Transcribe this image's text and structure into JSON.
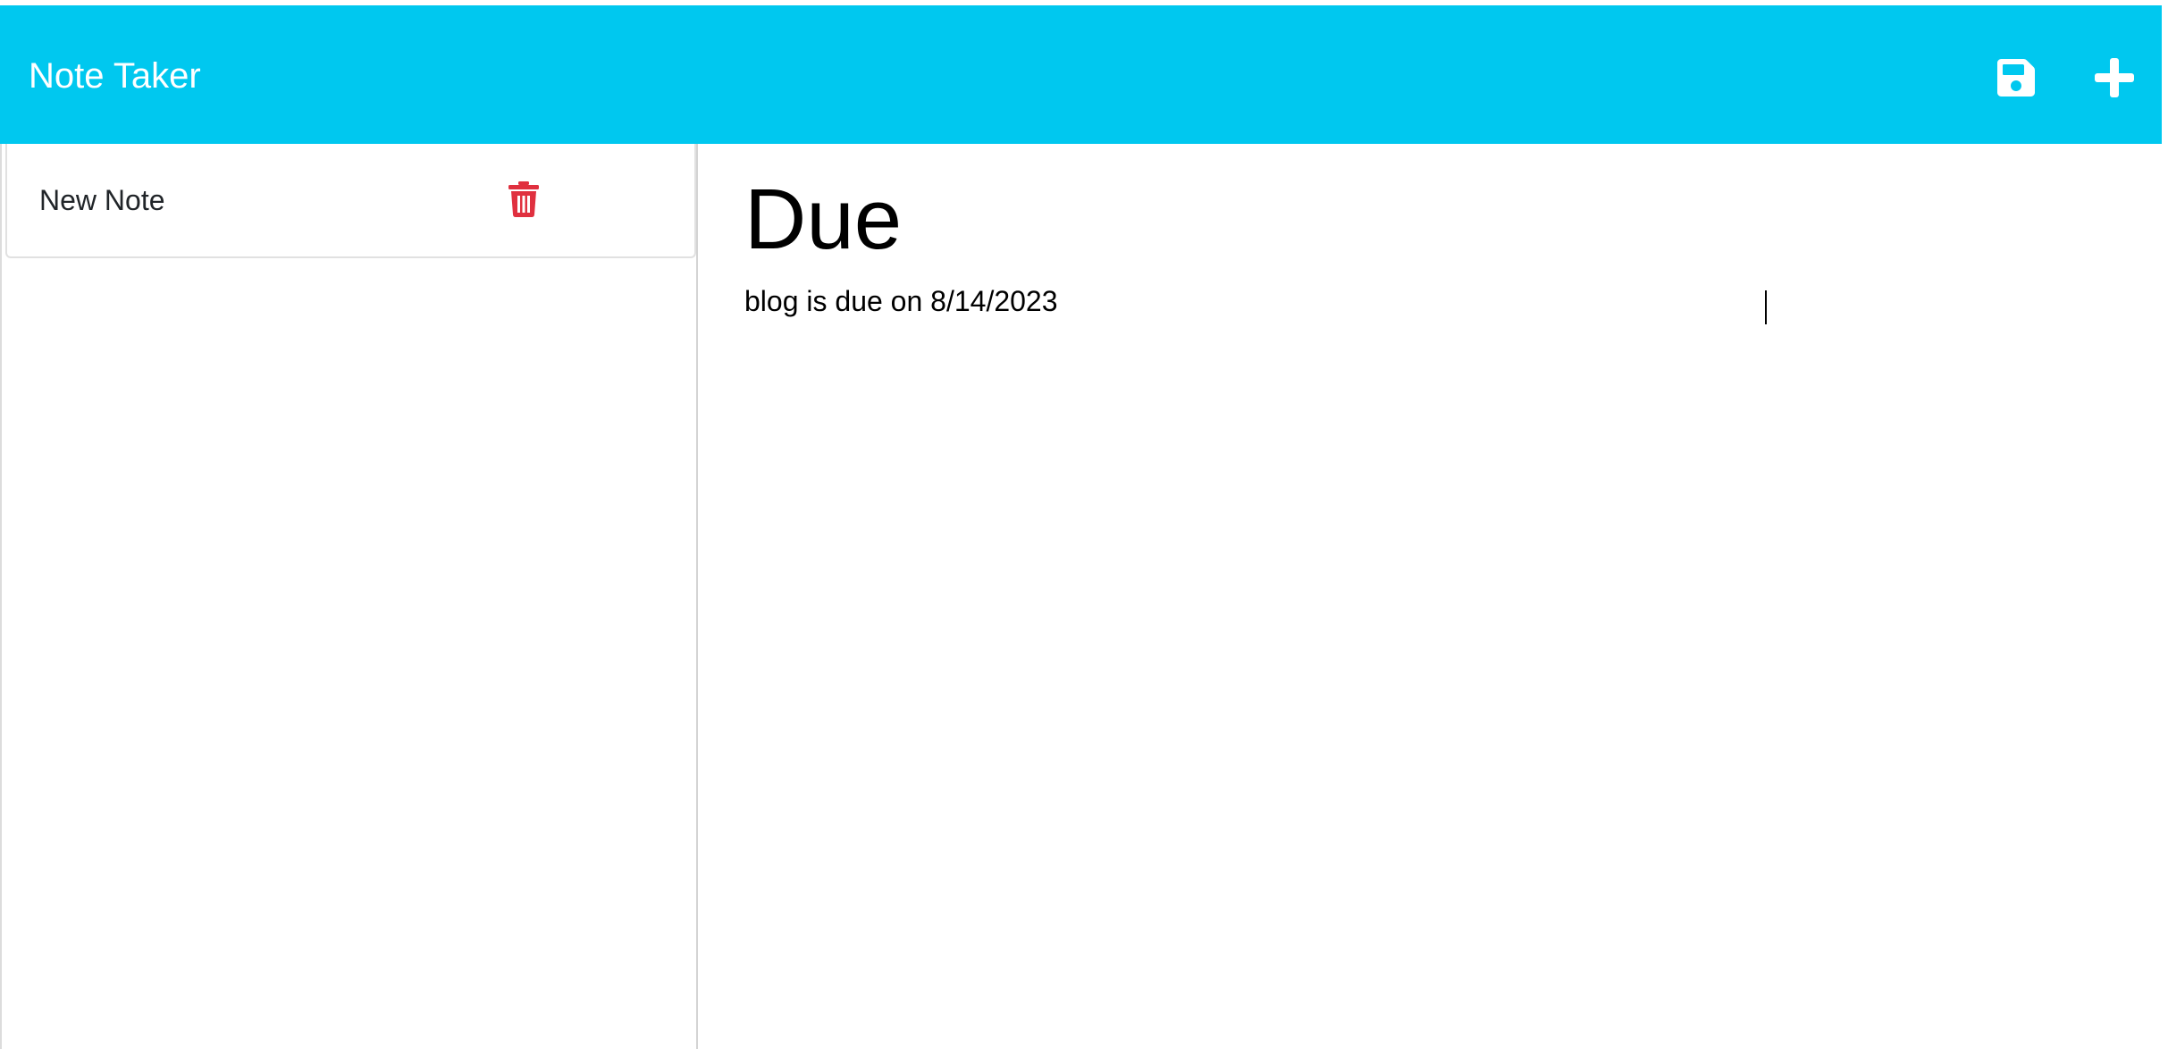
{
  "app": {
    "title": "Note Taker",
    "header_color": "#00c8ef"
  },
  "toolbar": {
    "save_icon": "save-icon",
    "add_icon": "plus-icon"
  },
  "sidebar": {
    "notes": [
      {
        "title": "New Note",
        "delete_icon": "trash-icon",
        "delete_color": "#e0303f"
      }
    ]
  },
  "editor": {
    "title_value": "Due",
    "text_value": "blog is due on 8/14/2023"
  }
}
